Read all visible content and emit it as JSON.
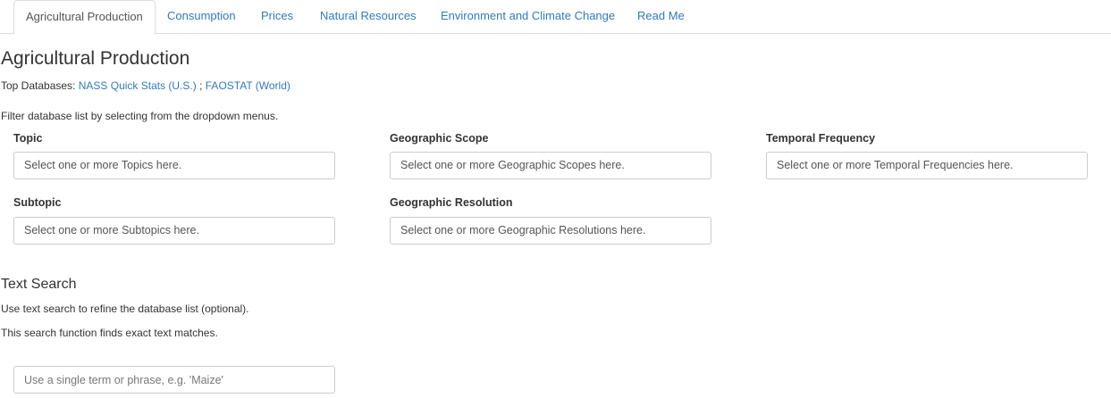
{
  "tabs": [
    {
      "label": "Agricultural Production",
      "active": true
    },
    {
      "label": "Consumption",
      "active": false
    },
    {
      "label": "Prices",
      "active": false
    },
    {
      "label": "Natural Resources",
      "active": false
    },
    {
      "label": "Environment and Climate Change",
      "active": false
    },
    {
      "label": "Read Me",
      "active": false
    }
  ],
  "page": {
    "title": "Agricultural Production",
    "top_databases_prefix": "Top Databases: ",
    "top_databases": [
      {
        "label": "NASS Quick Stats (U.S.)"
      },
      {
        "label": "FAOSTAT (World)"
      }
    ],
    "top_databases_separator": " ; ",
    "filter_instructions": "Filter database list by selecting from the dropdown menus."
  },
  "filters": {
    "topic": {
      "label": "Topic",
      "placeholder": "Select one or more Topics here."
    },
    "geographic_scope": {
      "label": "Geographic Scope",
      "placeholder": "Select one or more Geographic Scopes here."
    },
    "temporal_frequency": {
      "label": "Temporal Frequency",
      "placeholder": "Select one or more Temporal Frequencies here."
    },
    "subtopic": {
      "label": "Subtopic",
      "placeholder": "Select one or more Subtopics here."
    },
    "geographic_resolution": {
      "label": "Geographic Resolution",
      "placeholder": "Select one or more Geographic Resolutions here."
    }
  },
  "text_search": {
    "title": "Text Search",
    "help_1": "Use text search to refine the database list (optional).",
    "help_2": "This search function finds exact text matches.",
    "placeholder": "Use a single term or phrase, e.g. 'Maize'"
  },
  "colors": {
    "link": "#337ab7",
    "text": "#333333",
    "border": "#cccccc"
  }
}
